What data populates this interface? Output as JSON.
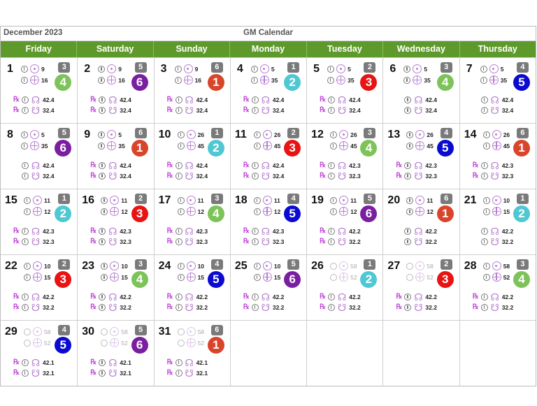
{
  "header": {
    "month": "December 2023",
    "title": "GM Calendar"
  },
  "weekdays": [
    "Friday",
    "Saturday",
    "Sunday",
    "Monday",
    "Tuesday",
    "Wednesday",
    "Thursday"
  ],
  "number_colors": {
    "1": "#d9452b",
    "2": "#4fc8d4",
    "3": "#e81313",
    "4": "#7dc35a",
    "5": "#0a0ad0",
    "6": "#7a1fa0"
  },
  "icons": {
    "phase": "info-circle-icon",
    "sun": "sun-icon",
    "earth": "earth-icon",
    "retrograde": "retrograde-icon",
    "north_node": "north-node-icon",
    "south_node": "south-node-icon"
  },
  "days": [
    {
      "day": "1",
      "sun": "9",
      "earth": "16",
      "badge": "3",
      "circle": "4",
      "node_n": "42.4",
      "node_s": "32.4",
      "retro": true,
      "faded": false
    },
    {
      "day": "2",
      "sun": "9",
      "earth": "16",
      "badge": "5",
      "circle": "6",
      "node_n": "42.4",
      "node_s": "32.4",
      "retro": true,
      "faded": false
    },
    {
      "day": "3",
      "sun": "9",
      "earth": "16",
      "badge": "6",
      "circle": "1",
      "node_n": "42.4",
      "node_s": "32.4",
      "retro": true,
      "faded": false
    },
    {
      "day": "4",
      "sun": "5",
      "earth": "35",
      "badge": "1",
      "circle": "2",
      "node_n": "42.4",
      "node_s": "32.4",
      "retro": true,
      "faded": false
    },
    {
      "day": "5",
      "sun": "5",
      "earth": "35",
      "badge": "2",
      "circle": "3",
      "node_n": "42.4",
      "node_s": "32.4",
      "retro": true,
      "faded": false
    },
    {
      "day": "6",
      "sun": "5",
      "earth": "35",
      "badge": "3",
      "circle": "4",
      "node_n": "42.4",
      "node_s": "32.4",
      "retro": false,
      "faded": false
    },
    {
      "day": "7",
      "sun": "5",
      "earth": "35",
      "badge": "4",
      "circle": "5",
      "node_n": "42.4",
      "node_s": "32.4",
      "retro": false,
      "faded": false
    },
    {
      "day": "8",
      "sun": "5",
      "earth": "35",
      "badge": "5",
      "circle": "6",
      "node_n": "42.4",
      "node_s": "32.4",
      "retro": false,
      "faded": false
    },
    {
      "day": "9",
      "sun": "5",
      "earth": "35",
      "badge": "6",
      "circle": "1",
      "node_n": "42.4",
      "node_s": "32.4",
      "retro": true,
      "faded": false
    },
    {
      "day": "10",
      "sun": "26",
      "earth": "45",
      "badge": "1",
      "circle": "2",
      "node_n": "42.4",
      "node_s": "32.4",
      "retro": true,
      "faded": false
    },
    {
      "day": "11",
      "sun": "26",
      "earth": "45",
      "badge": "2",
      "circle": "3",
      "node_n": "42.4",
      "node_s": "32.4",
      "retro": true,
      "faded": false
    },
    {
      "day": "12",
      "sun": "26",
      "earth": "45",
      "badge": "3",
      "circle": "4",
      "node_n": "42.3",
      "node_s": "32.3",
      "retro": true,
      "faded": false
    },
    {
      "day": "13",
      "sun": "26",
      "earth": "45",
      "badge": "4",
      "circle": "5",
      "node_n": "42.3",
      "node_s": "32.3",
      "retro": true,
      "faded": false
    },
    {
      "day": "14",
      "sun": "26",
      "earth": "45",
      "badge": "6",
      "circle": "1",
      "node_n": "42.3",
      "node_s": "32.3",
      "retro": true,
      "faded": false
    },
    {
      "day": "15",
      "sun": "11",
      "earth": "12",
      "badge": "1",
      "circle": "2",
      "node_n": "42.3",
      "node_s": "32.3",
      "retro": true,
      "faded": false
    },
    {
      "day": "16",
      "sun": "11",
      "earth": "12",
      "badge": "2",
      "circle": "3",
      "node_n": "42.3",
      "node_s": "32.3",
      "retro": true,
      "faded": false
    },
    {
      "day": "17",
      "sun": "11",
      "earth": "12",
      "badge": "3",
      "circle": "4",
      "node_n": "42.3",
      "node_s": "32.3",
      "retro": true,
      "faded": false
    },
    {
      "day": "18",
      "sun": "11",
      "earth": "12",
      "badge": "4",
      "circle": "5",
      "node_n": "42.3",
      "node_s": "32.3",
      "retro": true,
      "faded": false
    },
    {
      "day": "19",
      "sun": "11",
      "earth": "12",
      "badge": "5",
      "circle": "6",
      "node_n": "42.2",
      "node_s": "32.2",
      "retro": true,
      "faded": false
    },
    {
      "day": "20",
      "sun": "11",
      "earth": "12",
      "badge": "6",
      "circle": "1",
      "node_n": "42.2",
      "node_s": "32.2",
      "retro": false,
      "faded": false
    },
    {
      "day": "21",
      "sun": "10",
      "earth": "15",
      "badge": "1",
      "circle": "2",
      "node_n": "42.2",
      "node_s": "32.2",
      "retro": false,
      "faded": false
    },
    {
      "day": "22",
      "sun": "10",
      "earth": "15",
      "badge": "2",
      "circle": "3",
      "node_n": "42.2",
      "node_s": "32.2",
      "retro": true,
      "faded": false
    },
    {
      "day": "23",
      "sun": "10",
      "earth": "15",
      "badge": "3",
      "circle": "4",
      "node_n": "42.2",
      "node_s": "32.2",
      "retro": true,
      "faded": false
    },
    {
      "day": "24",
      "sun": "10",
      "earth": "15",
      "badge": "4",
      "circle": "5",
      "node_n": "42.2",
      "node_s": "32.2",
      "retro": true,
      "faded": false
    },
    {
      "day": "25",
      "sun": "10",
      "earth": "15",
      "badge": "5",
      "circle": "6",
      "node_n": "42.2",
      "node_s": "32.2",
      "retro": true,
      "faded": false
    },
    {
      "day": "26",
      "sun": "58",
      "earth": "52",
      "badge": "1",
      "circle": "2",
      "node_n": "42.2",
      "node_s": "32.2",
      "retro": true,
      "faded": true
    },
    {
      "day": "27",
      "sun": "58",
      "earth": "52",
      "badge": "2",
      "circle": "3",
      "node_n": "42.2",
      "node_s": "32.2",
      "retro": true,
      "faded": true
    },
    {
      "day": "28",
      "sun": "58",
      "earth": "52",
      "badge": "3",
      "circle": "4",
      "node_n": "42.2",
      "node_s": "32.2",
      "retro": true,
      "faded": false
    },
    {
      "day": "29",
      "sun": "58",
      "earth": "52",
      "badge": "4",
      "circle": "5",
      "node_n": "42.1",
      "node_s": "32.1",
      "retro": true,
      "faded": true
    },
    {
      "day": "30",
      "sun": "58",
      "earth": "52",
      "badge": "5",
      "circle": "6",
      "node_n": "42.1",
      "node_s": "32.1",
      "retro": true,
      "faded": true
    },
    {
      "day": "31",
      "sun": "58",
      "earth": "52",
      "badge": "6",
      "circle": "1",
      "node_n": "42.1",
      "node_s": "32.1",
      "retro": true,
      "faded": true
    }
  ],
  "symbols": {
    "retrograde": "℞",
    "north_node": "☊",
    "south_node": "☋"
  }
}
